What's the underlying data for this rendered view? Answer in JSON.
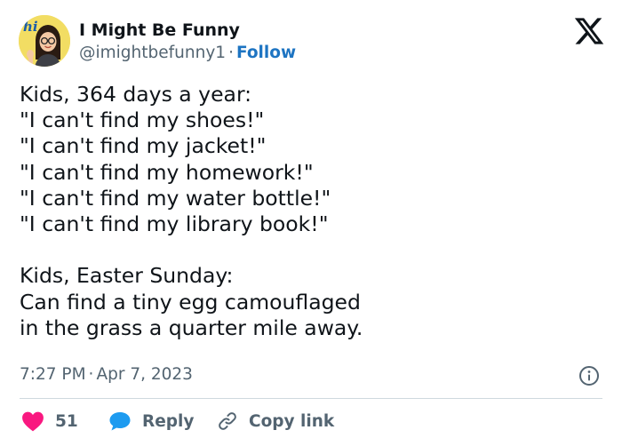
{
  "author": {
    "name": "I Might Be Funny",
    "handle": "@imightbefunny1",
    "separator": "·",
    "follow_label": "Follow",
    "avatar_text": "hi"
  },
  "tweet": {
    "text": "Kids, 364 days a year:\n\"I can't find my shoes!\"\n\"I can't find my jacket!\"\n\"I can't find my homework!\"\n\"I can't find my water bottle!\"\n\"I can't find my library book!\"\n\nKids, Easter Sunday:\nCan find a tiny egg camouflaged\nin the grass a quarter mile away.",
    "time": "7:27 PM",
    "separator": "·",
    "date": "Apr 7, 2023"
  },
  "actions": {
    "like_count": "51",
    "reply_label": "Reply",
    "copy_link_label": "Copy link"
  },
  "colors": {
    "text": "#0f1419",
    "secondary": "#536471",
    "link": "#1d74c2",
    "like": "#f91880",
    "reply": "#1d9bf0",
    "avatar_bg": "#f2dd63"
  },
  "icons": {
    "brand": "x-logo-icon",
    "info": "info-icon",
    "like": "heart-icon",
    "reply": "speech-bubble-icon",
    "copy": "link-icon"
  }
}
